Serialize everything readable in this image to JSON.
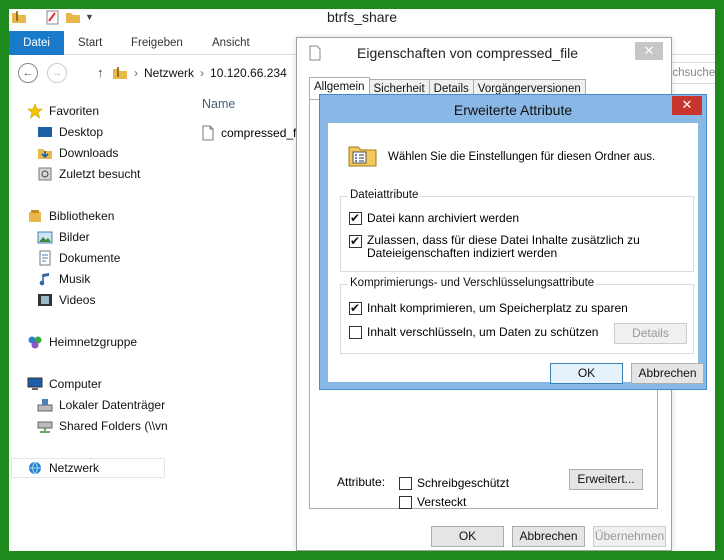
{
  "window": {
    "title": "btrfs_share"
  },
  "ribbon": {
    "tabs": [
      "Datei",
      "Start",
      "Freigeben",
      "Ansicht"
    ]
  },
  "address": {
    "crumbs": [
      "Netzwerk",
      "10.120.66.234"
    ],
    "search_placeholder": "uchsuchen"
  },
  "nav": {
    "favorites": "Favoriten",
    "desktop": "Desktop",
    "downloads": "Downloads",
    "recent": "Zuletzt besucht",
    "libraries": "Bibliotheken",
    "pictures": "Bilder",
    "documents": "Dokumente",
    "music": "Musik",
    "videos": "Videos",
    "homegroup": "Heimnetzgruppe",
    "computer": "Computer",
    "local_disk": "Lokaler Datenträger",
    "shared": "Shared Folders (\\\\vn",
    "network": "Netzwerk"
  },
  "content": {
    "column_name": "Name",
    "file": "compressed_f"
  },
  "props": {
    "title": "Eigenschaften von compressed_file",
    "close": "✕",
    "tabs": [
      "Allgemein",
      "Sicherheit",
      "Details",
      "Vorgängerversionen"
    ],
    "attributes_label": "Attribute:",
    "readonly": "Schreibgeschützt",
    "hidden": "Versteckt",
    "advanced_btn": "Erweitert...",
    "ok": "OK",
    "cancel": "Abbrechen",
    "apply": "Übernehmen"
  },
  "adv": {
    "title": "Erweiterte Attribute",
    "close": "✕",
    "intro": "Wählen Sie die Einstellungen für diesen Ordner aus.",
    "file_attr_group": "Dateiattribute",
    "archive": "Datei kann archiviert werden",
    "index_line1": "Zulassen, dass für diese Datei Inhalte zusätzlich zu",
    "index_line2": "Dateieigenschaften indiziert werden",
    "compress_group": "Komprimierungs- und Verschlüsselungsattribute",
    "compress": "Inhalt komprimieren, um Speicherplatz zu sparen",
    "encrypt": "Inhalt verschlüsseln, um Daten zu schützen",
    "details_btn": "Details",
    "ok": "OK",
    "cancel": "Abbrechen"
  },
  "colors": {
    "accent": "#1979ca",
    "frame_border": "#1e8a1e",
    "close_red": "#c7352e",
    "dialog_frame": "#8ab8e6"
  }
}
